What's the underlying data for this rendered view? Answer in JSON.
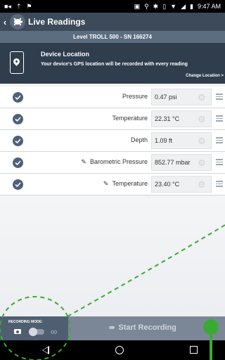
{
  "status_bar": {
    "left_icons": [
      "video-icon",
      "upload-icon",
      "signal-flag-icon"
    ],
    "right_icons": [
      "cast-icon",
      "location-pin-icon",
      "bluetooth-icon",
      "vibrate-icon",
      "wifi-icon",
      "no-signal-icon",
      "battery-icon"
    ],
    "time": "9:47 AM"
  },
  "app_bar": {
    "title": "Live Readings"
  },
  "device": {
    "label": "Level TROLL 500 - SN 166274"
  },
  "location_card": {
    "title": "Device Location",
    "description": "Your device's GPS location will be recorded with every reading",
    "change_link": "Change Location >"
  },
  "parameters": [
    {
      "name": "Pressure",
      "value": "0.47 psi",
      "editable": false
    },
    {
      "name": "Temperature",
      "value": "22.31 °C",
      "editable": false
    },
    {
      "name": "Depth",
      "value": "1.09 ft",
      "editable": false
    },
    {
      "name": "Barometric Pressure",
      "value": "852.77 mbar",
      "editable": true
    },
    {
      "name": "Temperature",
      "value": "23.40 °C",
      "editable": true
    }
  ],
  "recording": {
    "mode_label": "RECORDING MODE:",
    "start_label": "Start Recording"
  },
  "colors": {
    "app_bar": "#3c4a5a",
    "device_bar": "#5c6d80",
    "location_card": "#2f3d4d",
    "bottom_bar": "#7b8797",
    "annotation_green": "#3aaa35"
  }
}
